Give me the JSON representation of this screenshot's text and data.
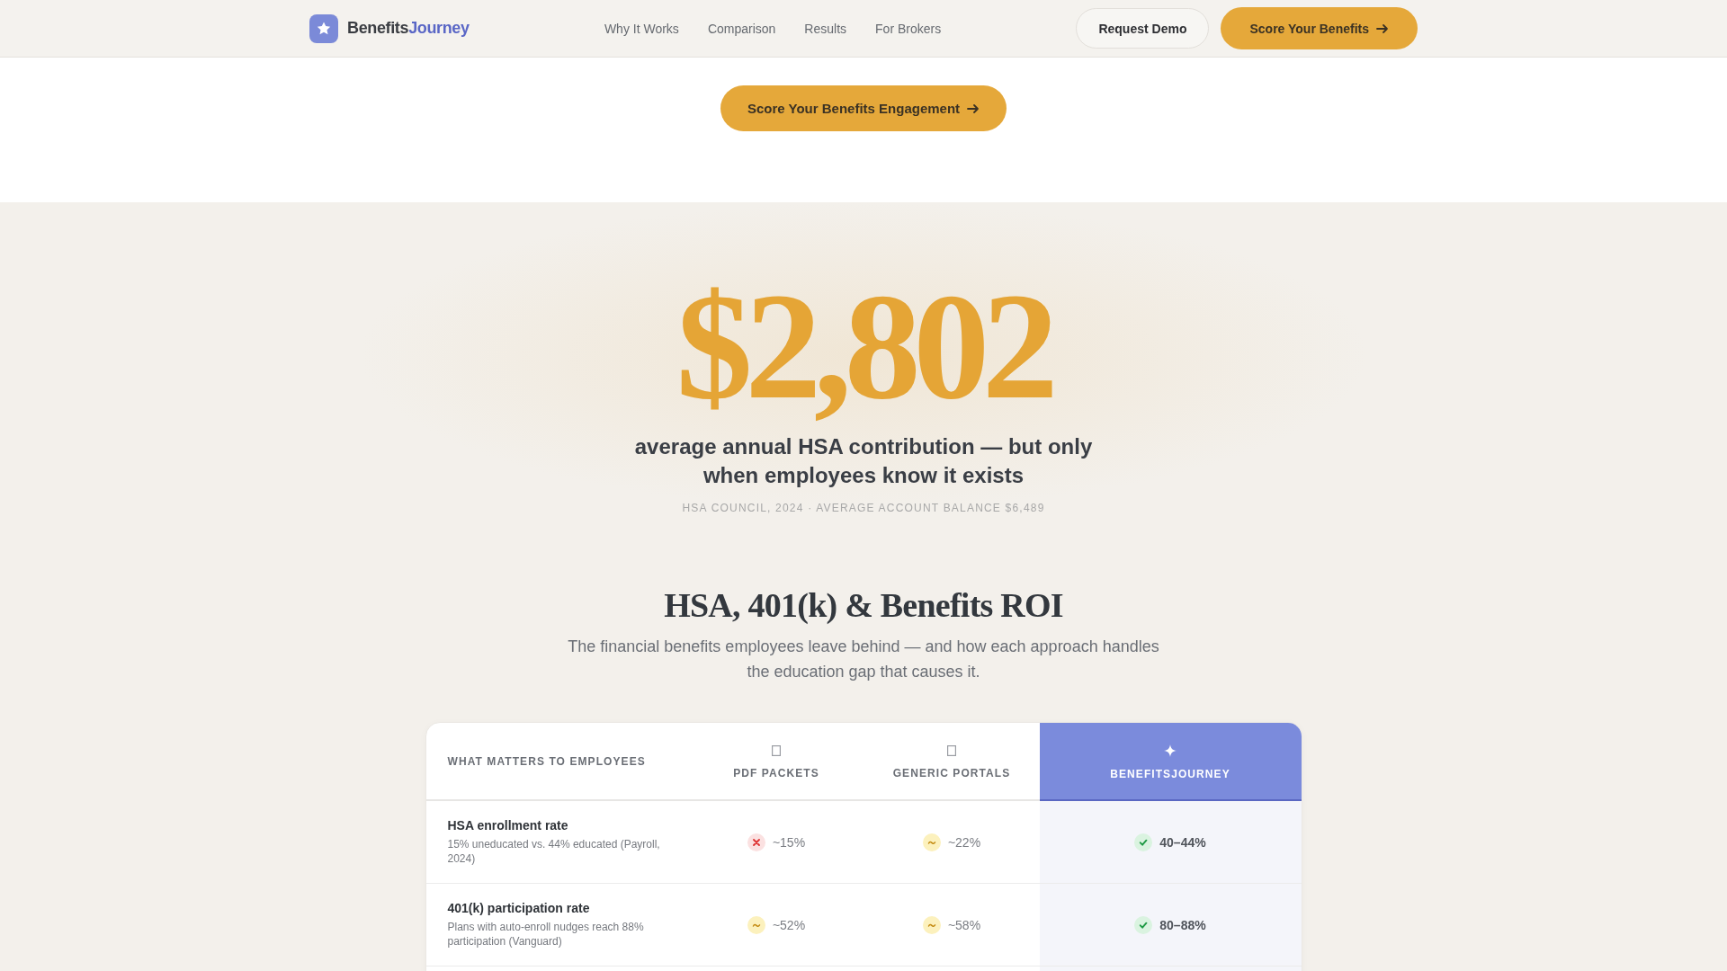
{
  "nav": {
    "brand": {
      "name": "Benefits",
      "accent": "Journey"
    },
    "links": [
      "Why It Works",
      "Comparison",
      "Results",
      "For Brokers"
    ],
    "buttons": [
      {
        "label": "Request Demo",
        "kind": "secondary"
      },
      {
        "label": "Score Your Benefits",
        "kind": "primary"
      }
    ]
  },
  "hero": {
    "cta": "Score Your Benefits Engagement"
  },
  "stat": {
    "value": "$2,802",
    "caption": "average annual HSA contribution — but only when employees know it exists",
    "source": "HSA COUNCIL, 2024 · AVERAGE ACCOUNT BALANCE $6,489"
  },
  "section": {
    "title": "HSA, 401(k) & Benefits ROI",
    "subtitle": "The financial benefits employees leave behind — and how each approach handles the education gap that causes it."
  },
  "table": {
    "columns": [
      {
        "label": "WHAT MATTERS TO EMPLOYEES",
        "kind": "criterion"
      },
      {
        "label": "PDF PACKETS",
        "kind": "competitor"
      },
      {
        "label": "GENERIC PORTALS",
        "kind": "competitor"
      },
      {
        "label": "BENEFITSJOURNEY",
        "kind": "featured"
      }
    ],
    "rows": [
      {
        "cells": [
          {
            "kind": "criterion",
            "title": "HSA enrollment rate",
            "note": "15% uneducated vs. 44% educated (Payroll, 2024)"
          },
          {
            "kind": "negative",
            "value": "~15%"
          },
          {
            "kind": "partial",
            "value": "~22%"
          },
          {
            "kind": "positive",
            "value": "40–44%"
          }
        ]
      },
      {
        "cells": [
          {
            "kind": "criterion",
            "title": "401(k) participation rate",
            "note": "Plans with auto-enroll nudges reach 88% participation (Vanguard)"
          },
          {
            "kind": "partial",
            "value": "~52%"
          },
          {
            "kind": "partial",
            "value": "~58%"
          },
          {
            "kind": "positive",
            "value": "80–88%"
          }
        ]
      }
    ]
  }
}
